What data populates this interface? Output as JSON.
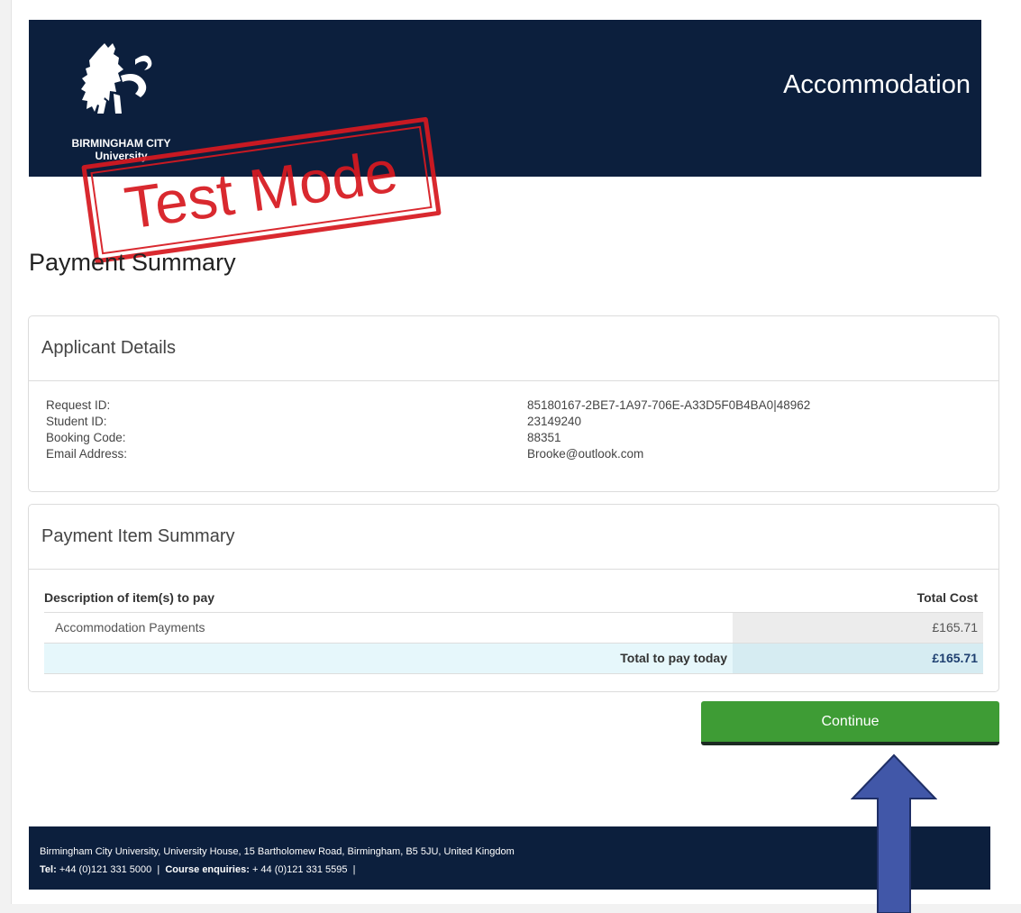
{
  "header": {
    "logo_line1": "BIRMINGHAM CITY",
    "logo_line2": "University",
    "title": "Accommodation",
    "background_color": "#0c1f3d"
  },
  "stamp": {
    "text": "Test Mode",
    "color": "#d71920"
  },
  "page_title": "Payment Summary",
  "applicant": {
    "heading": "Applicant Details",
    "rows": [
      {
        "label": "Request ID:",
        "value": "85180167-2BE7-1A97-706E-A33D5F0B4BA0|48962"
      },
      {
        "label": "Student ID:",
        "value": "23149240"
      },
      {
        "label": "Booking Code:",
        "value": "88351"
      },
      {
        "label": "Email Address:",
        "value": "Brooke@outlook.com"
      }
    ]
  },
  "payment_items": {
    "heading": "Payment Item Summary",
    "col_description": "Description of item(s) to pay",
    "col_cost": "Total Cost",
    "items": [
      {
        "description": "Accommodation Payments",
        "cost": "£165.71"
      }
    ],
    "total_label": "Total to pay today",
    "total_value": "£165.71"
  },
  "continue_button": {
    "label": "Continue",
    "color": "#3e9c35"
  },
  "footer": {
    "address": "Birmingham City University, University House, 15 Bartholomew Road, Birmingham, B5 5JU, United Kingdom",
    "tel_label": "Tel:",
    "tel_value": "+44 (0)121 331 5000",
    "enquiries_label": "Course enquiries:",
    "enquiries_value": "+ 44 (0)121 331 5595"
  },
  "annotation": {
    "icon": "arrow-up-icon",
    "color": "#4157a8"
  }
}
